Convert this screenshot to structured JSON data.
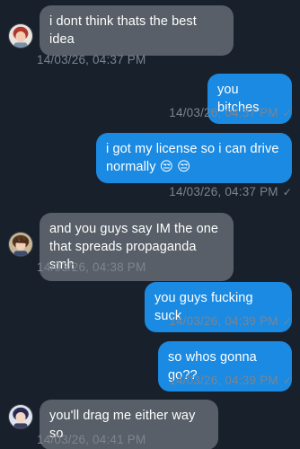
{
  "chat": {
    "messages": [
      {
        "direction": "incoming",
        "text": "i dont think thats the best idea",
        "time": "14/03/26, 04:37 PM",
        "avatar_icon": "avatar-red-hair-icon"
      },
      {
        "direction": "outgoing",
        "text": "you bitches",
        "time": "14/03/26, 04:37 PM",
        "status": "✓"
      },
      {
        "direction": "outgoing",
        "text": "i got my license so i can drive normally 😒 😒",
        "time": "14/03/26, 04:37 PM",
        "status": "✓"
      },
      {
        "direction": "incoming",
        "text": "and you guys say IM the one that spreads propaganda smh",
        "time": "14/03/26, 04:38 PM",
        "avatar_icon": "avatar-brown-hair-icon"
      },
      {
        "direction": "outgoing",
        "text": "you guys fucking suck",
        "time": "14/03/26, 04:39 PM",
        "status": "✓"
      },
      {
        "direction": "outgoing",
        "text": "so whos gonna go??",
        "time": "14/03/26, 04:39 PM",
        "status": "✓"
      },
      {
        "direction": "incoming",
        "text": "you'll drag me either way so",
        "time": "14/03/26, 04:41 PM",
        "avatar_icon": "avatar-dark-hair-icon"
      }
    ]
  },
  "colors": {
    "background": "#18202b",
    "incoming_bubble": "#585f68",
    "outgoing_bubble": "#1a8ae2",
    "timestamp": "#7b8591"
  }
}
